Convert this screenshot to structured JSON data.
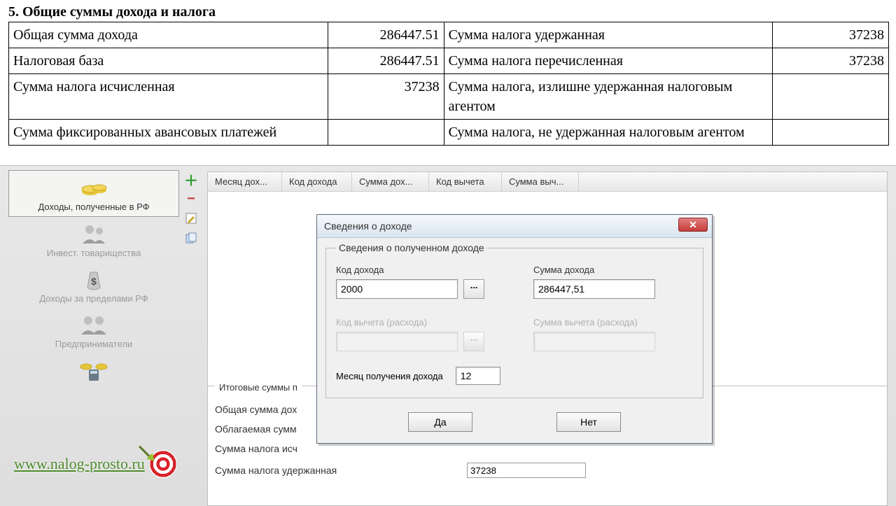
{
  "doc": {
    "section_title": "5. Общие суммы дохода и налога",
    "rows": [
      {
        "l1": "Общая сумма дохода",
        "v1": "286447.51",
        "l2": "Сумма налога удержанная",
        "v2": "37238"
      },
      {
        "l1": "Налоговая база",
        "v1": "286447.51",
        "l2": "Сумма налога перечисленная",
        "v2": "37238"
      },
      {
        "l1": "Сумма налога исчисленная",
        "v1": "37238",
        "l2": "Сумма налога, излишне удержанная налоговым агентом",
        "v2": ""
      },
      {
        "l1": "Сумма фиксированных авансовых платежей",
        "v1": "",
        "l2": "Сумма налога, не удержанная налоговым агентом",
        "v2": ""
      }
    ]
  },
  "sidebar": {
    "items": [
      {
        "label": "Доходы, полученные в РФ"
      },
      {
        "label": "Инвест. товарищества"
      },
      {
        "label": "Доходы за пределами РФ"
      },
      {
        "label": "Предприниматели"
      },
      {
        "label": ""
      }
    ]
  },
  "grid": {
    "headers": [
      "Месяц дох...",
      "Код дохода",
      "Сумма дох...",
      "Код вычета",
      "Сумма выч..."
    ]
  },
  "summary": {
    "legend": "Итоговые суммы п",
    "rows": [
      {
        "l": "Общая сумма дох"
      },
      {
        "l": "Облагаемая сумм"
      },
      {
        "l": "Сумма налога исч"
      },
      {
        "l": "Сумма налога удержанная",
        "v": "37238"
      }
    ]
  },
  "dialog": {
    "title": "Сведения о доходе",
    "legend": "Сведения о полученном доходе",
    "code_label": "Код дохода",
    "code_value": "2000",
    "sum_label": "Сумма дохода",
    "sum_value": "286447,51",
    "ded_code_label": "Код вычета (расхода)",
    "ded_sum_label": "Сумма вычета (расхода)",
    "month_label": "Месяц получения дохода",
    "month_value": "12",
    "ok": "Да",
    "cancel": "Нет"
  },
  "watermark": "www.nalog-prosto.ru"
}
